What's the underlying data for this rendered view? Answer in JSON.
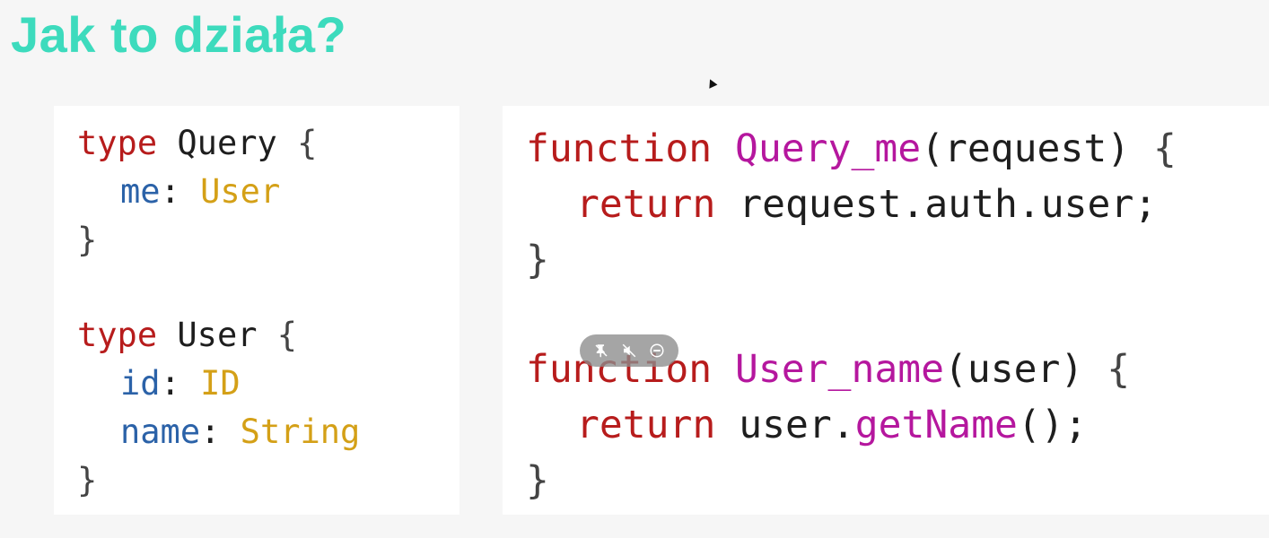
{
  "slide": {
    "title": "Jak to działa?"
  },
  "colors": {
    "title": "#3ddbbd",
    "keyword": "#b71c1c",
    "field": "#2b62a8",
    "type": "#d4a017",
    "function_name": "#b5179e",
    "text": "#1e1e1e",
    "brace": "#444444"
  },
  "schema": {
    "type_kw": "type",
    "query_type": "Query",
    "me_field": "me",
    "me_type": "User",
    "user_type": "User",
    "id_field": "id",
    "id_type": "ID",
    "name_field": "name",
    "name_type": "String",
    "open_brace": "{",
    "close_brace": "}",
    "colon": ":"
  },
  "resolvers": {
    "function_kw": "function",
    "return_kw": "return",
    "query_me_name": "Query_me",
    "query_me_param": "(request)",
    "query_me_body": "request.auth.user;",
    "user_name_name": "User_name",
    "user_name_param": "(user)",
    "user_name_body_obj": "user.",
    "user_name_body_method": "getName",
    "user_name_body_end": "();",
    "open_brace": "{",
    "close_brace": "}"
  },
  "video_controls": {
    "icons": [
      "pin-off-icon",
      "mute-icon",
      "minus-circle-icon"
    ]
  }
}
